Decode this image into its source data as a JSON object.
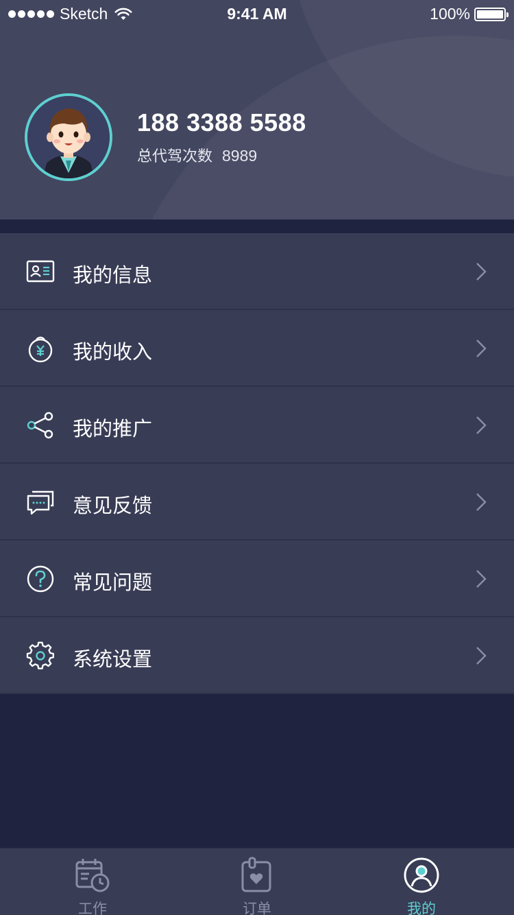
{
  "status_bar": {
    "carrier": "Sketch",
    "time": "9:41 AM",
    "battery": "100%"
  },
  "profile": {
    "phone": "188 3388 5588",
    "ride_label": "总代驾次数",
    "ride_count": "8989"
  },
  "menu": [
    {
      "label": "我的信息",
      "icon": "id-card-icon"
    },
    {
      "label": "我的收入",
      "icon": "money-bag-icon"
    },
    {
      "label": "我的推广",
      "icon": "share-icon"
    },
    {
      "label": "意见反馈",
      "icon": "feedback-icon"
    },
    {
      "label": "常见问题",
      "icon": "question-icon"
    },
    {
      "label": "系统设置",
      "icon": "gear-icon"
    }
  ],
  "tabbar": [
    {
      "label": "工作",
      "icon": "calendar-clock-icon",
      "active": false
    },
    {
      "label": "订单",
      "icon": "order-icon",
      "active": false
    },
    {
      "label": "我的",
      "icon": "user-icon",
      "active": true
    }
  ],
  "colors": {
    "accent": "#5ecfcf",
    "header_bg": "#42465f",
    "menu_bg": "#383c55",
    "page_bg": "#1f2340",
    "tab_inactive": "#8a8ea6"
  }
}
